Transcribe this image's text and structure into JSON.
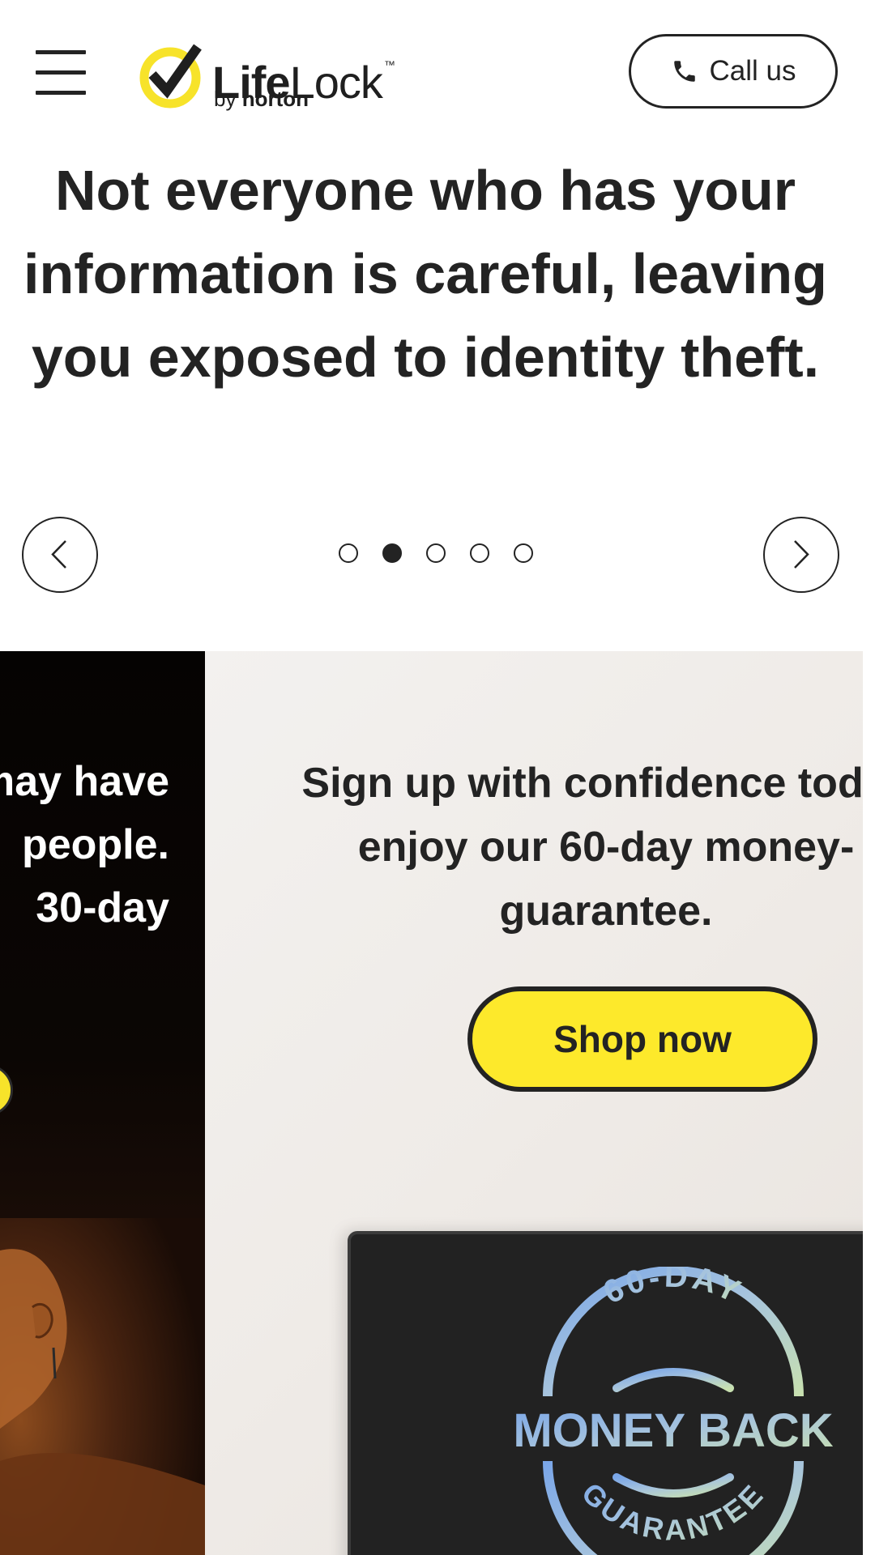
{
  "header": {
    "menu_icon": "hamburger-menu-icon",
    "logo": {
      "word_bold": "Life",
      "word_light": "Lock",
      "trademark": "™",
      "by": "by",
      "brand": "norton"
    },
    "call_button": {
      "icon": "phone-icon",
      "label": "Call us"
    }
  },
  "carousel": {
    "headline": "Not everyone who has your information is careful, leaving you exposed to identity theft.",
    "prev_icon": "chevron-left-icon",
    "next_icon": "chevron-right-icon",
    "dot_count": 5,
    "active_dot": 2
  },
  "slides": {
    "dark_slide": {
      "lines": [
        "may have",
        "people.",
        "30-day"
      ]
    },
    "light_slide": {
      "lines": [
        "Sign up with confidence today",
        "enjoy our 60-day money-",
        "guarantee."
      ],
      "shop_button": "Shop now",
      "badge": {
        "top": "60-DAY",
        "middle": "MONEY BACK",
        "bottom": "GUARANTEE"
      }
    }
  },
  "colors": {
    "text": "#232323",
    "brand_yellow": "#fde92b",
    "logo_yellow": "#f7e32a",
    "light_slide_bg": "#efebe7",
    "dark_slide_bg": "#0b0604"
  }
}
